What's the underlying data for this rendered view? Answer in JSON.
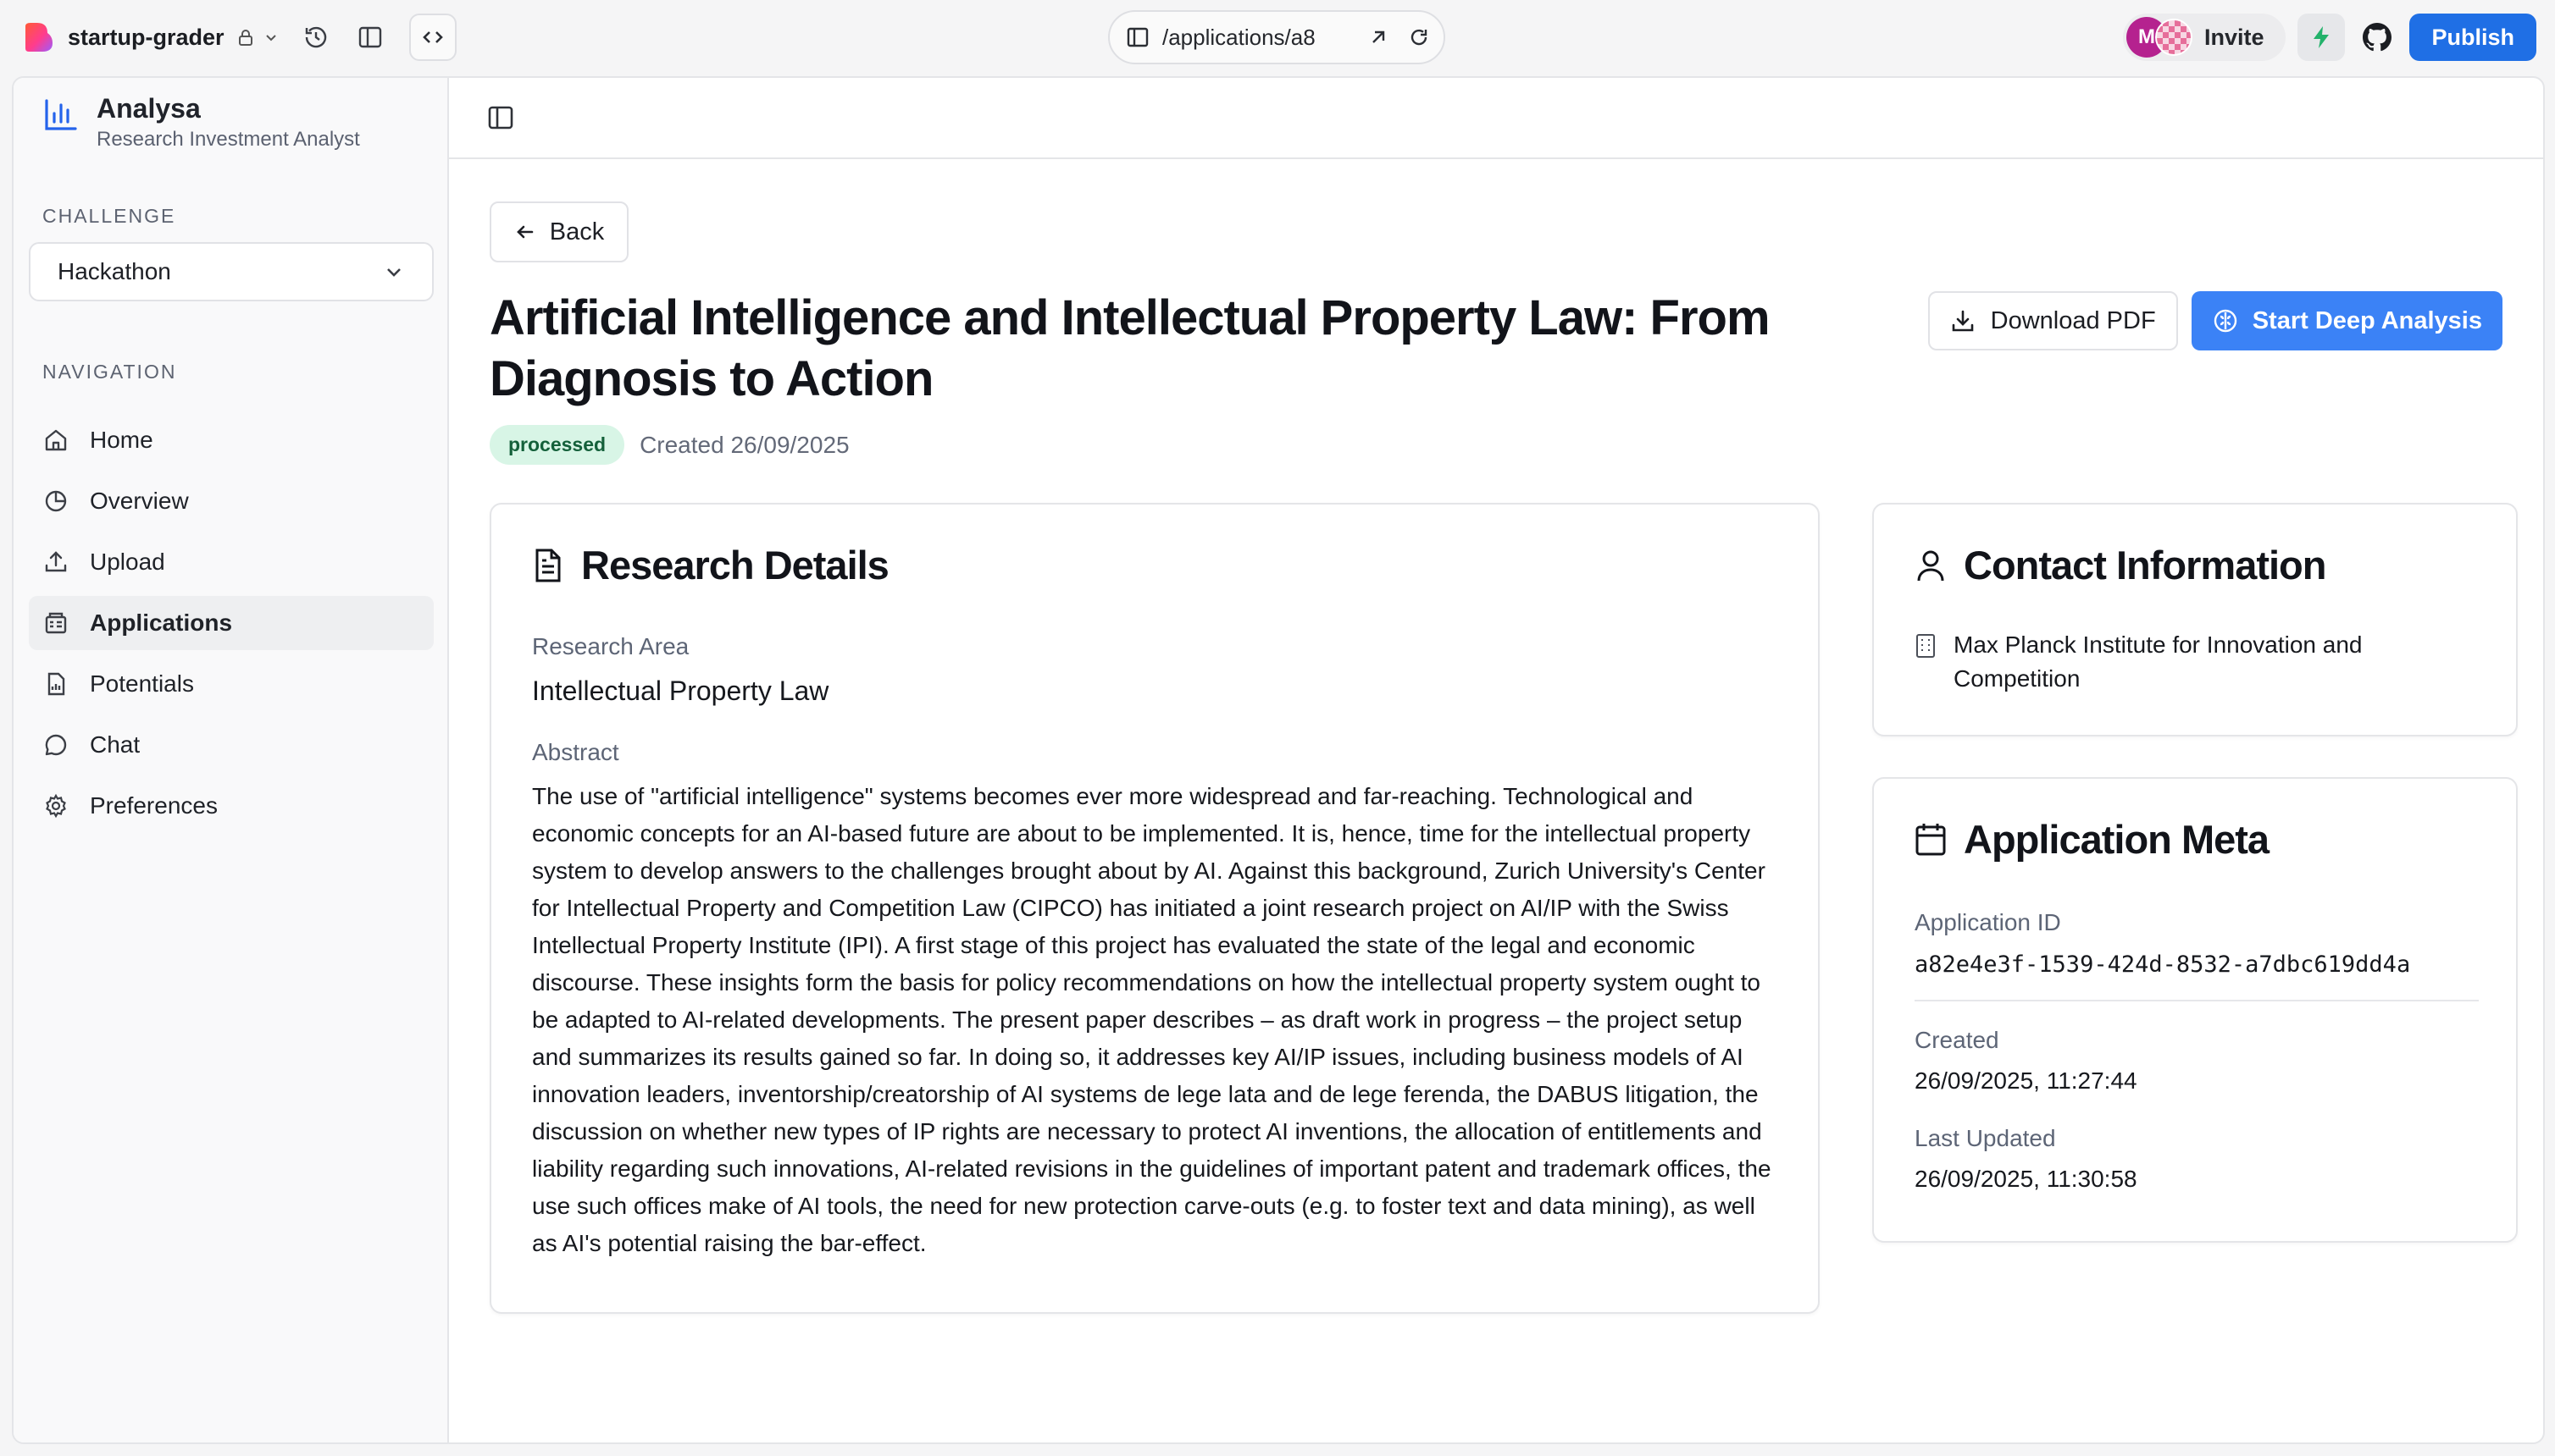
{
  "topbar": {
    "project_name": "startup-grader",
    "url_path": "/applications/a8",
    "avatar_initial": "M",
    "invite_label": "Invite",
    "publish_label": "Publish"
  },
  "sidebar": {
    "brand_name": "Analysa",
    "brand_subtitle": "Research Investment Analyst",
    "challenge_label": "CHALLENGE",
    "challenge_value": "Hackathon",
    "navigation_label": "NAVIGATION",
    "items": [
      {
        "label": "Home",
        "icon": "home-icon"
      },
      {
        "label": "Overview",
        "icon": "pie-chart-icon"
      },
      {
        "label": "Upload",
        "icon": "upload-icon"
      },
      {
        "label": "Applications",
        "icon": "applications-icon",
        "active": true
      },
      {
        "label": "Potentials",
        "icon": "potentials-icon"
      },
      {
        "label": "Chat",
        "icon": "chat-icon"
      },
      {
        "label": "Preferences",
        "icon": "gear-icon"
      }
    ]
  },
  "page": {
    "back_label": "Back",
    "title": "Artificial Intelligence and Intellectual Property Law: From Diagnosis to Action",
    "status": "processed",
    "created": "Created 26/09/2025",
    "download_label": "Download PDF",
    "deep_analysis_label": "Start Deep Analysis"
  },
  "research": {
    "title": "Research Details",
    "area_label": "Research Area",
    "area_value": "Intellectual Property Law",
    "abstract_label": "Abstract",
    "abstract": "The use of \"artificial intelligence\" systems becomes ever more widespread and far-reaching. Technological and economic concepts for an AI-based future are about to be implemented. It is, hence, time for the intellectual property system to develop answers to the challenges brought about by AI. Against this background, Zurich University's Center for Intellectual Property and Competition Law (CIPCO) has initiated a joint research project on AI/IP with the Swiss Intellectual Property Institute (IPI). A first stage of this project has evaluated the state of the legal and economic discourse. These insights form the basis for policy recommendations on how the intellectual property system ought to be adapted to AI-related developments. The present paper describes – as draft work in progress – the project setup and summarizes its results gained so far. In doing so, it addresses key AI/IP issues, including business models of AI innovation leaders, inventorship/creatorship of AI systems de lege lata and de lege ferenda, the DABUS litigation, the discussion on whether new types of IP rights are necessary to protect AI inventions, the allocation of entitlements and liability regarding such innovations, AI-related revisions in the guidelines of important patent and trademark offices, the use such offices make of AI tools, the need for new protection carve-outs (e.g. to foster text and data mining), as well as AI's potential raising the bar-effect."
  },
  "contact": {
    "title": "Contact Information",
    "institution": "Max Planck Institute for Innovation and Competition"
  },
  "meta": {
    "title": "Application Meta",
    "id_label": "Application ID",
    "id_value": "a82e4e3f-1539-424d-8532-a7dbc619dd4a",
    "created_label": "Created",
    "created_value": "26/09/2025, 11:27:44",
    "updated_label": "Last Updated",
    "updated_value": "26/09/2025, 11:30:58"
  }
}
